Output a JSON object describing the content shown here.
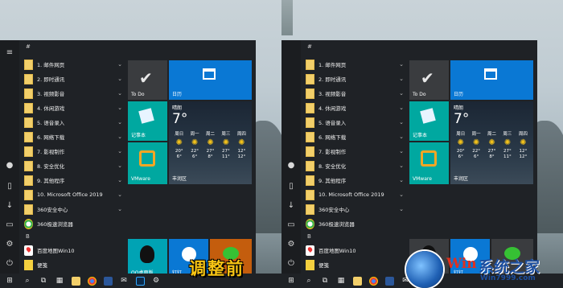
{
  "left_caption": "调整前",
  "watermark": {
    "brand_latin": "Win",
    "brand_cn": "系统之家",
    "url": "Win7999.com"
  },
  "section_letters": {
    "hash": "#",
    "b": "B"
  },
  "apps": [
    {
      "label": "1. 邮件网页",
      "chev": "⌄",
      "icon": "folder"
    },
    {
      "label": "2. 即时通讯",
      "chev": "⌄",
      "icon": "folder"
    },
    {
      "label": "3. 视频影音",
      "chev": "⌄",
      "icon": "folder"
    },
    {
      "label": "4. 休闲游戏",
      "chev": "⌄",
      "icon": "folder"
    },
    {
      "label": "5. 语音录入",
      "chev": "⌄",
      "icon": "folder"
    },
    {
      "label": "6. 网络下载",
      "chev": "⌄",
      "icon": "folder"
    },
    {
      "label": "7. 影视制作",
      "chev": "⌄",
      "icon": "folder"
    },
    {
      "label": "8. 安全优化",
      "chev": "⌄",
      "icon": "folder"
    },
    {
      "label": "9. 其他程序",
      "chev": "⌄",
      "icon": "folder"
    },
    {
      "label": "10. Microsoft Office 2019",
      "chev": "⌄",
      "icon": "folder"
    },
    {
      "label": "360安全中心",
      "chev": "⌄",
      "icon": "folder"
    },
    {
      "label": "360极速浏览器",
      "chev": "",
      "icon": "browser"
    },
    {
      "label": "百度地图Win10",
      "chev": "",
      "icon": "map"
    },
    {
      "label": "便笺",
      "chev": "",
      "icon": "note"
    }
  ],
  "tiles": {
    "todo": "To Do",
    "calendar": "日历",
    "notepad": "记事本",
    "vmware": "VMware",
    "qq": "QQ桌面版",
    "dingding": "钉钉",
    "wechat": "微信"
  },
  "weather": {
    "condition": "晴朗",
    "temp": "7°",
    "city": "丰润区",
    "days": [
      {
        "day": "周日",
        "hi": "20°",
        "lo": "6°"
      },
      {
        "day": "周一",
        "hi": "22°",
        "lo": "6°"
      },
      {
        "day": "周二",
        "hi": "27°",
        "lo": "8°"
      },
      {
        "day": "周三",
        "hi": "27°",
        "lo": "11°"
      },
      {
        "day": "周四",
        "hi": "12°",
        "lo": "12°"
      }
    ]
  },
  "rail_icons": [
    "hamburger-icon",
    "user-icon",
    "document-icon",
    "download-icon",
    "pictures-icon",
    "settings-icon",
    "power-icon"
  ],
  "taskbar_icons": [
    "windows-icon",
    "search-icon",
    "taskview-icon",
    "calculator-icon",
    "explorer-icon",
    "chrome-icon",
    "word-icon",
    "mail-icon",
    "photoshop-icon",
    "settings-icon"
  ],
  "colors": {
    "accent_blue": "#0a78d4",
    "teal": "#00a8a0",
    "orange": "#c45d0d",
    "caption": "#f7c514"
  }
}
